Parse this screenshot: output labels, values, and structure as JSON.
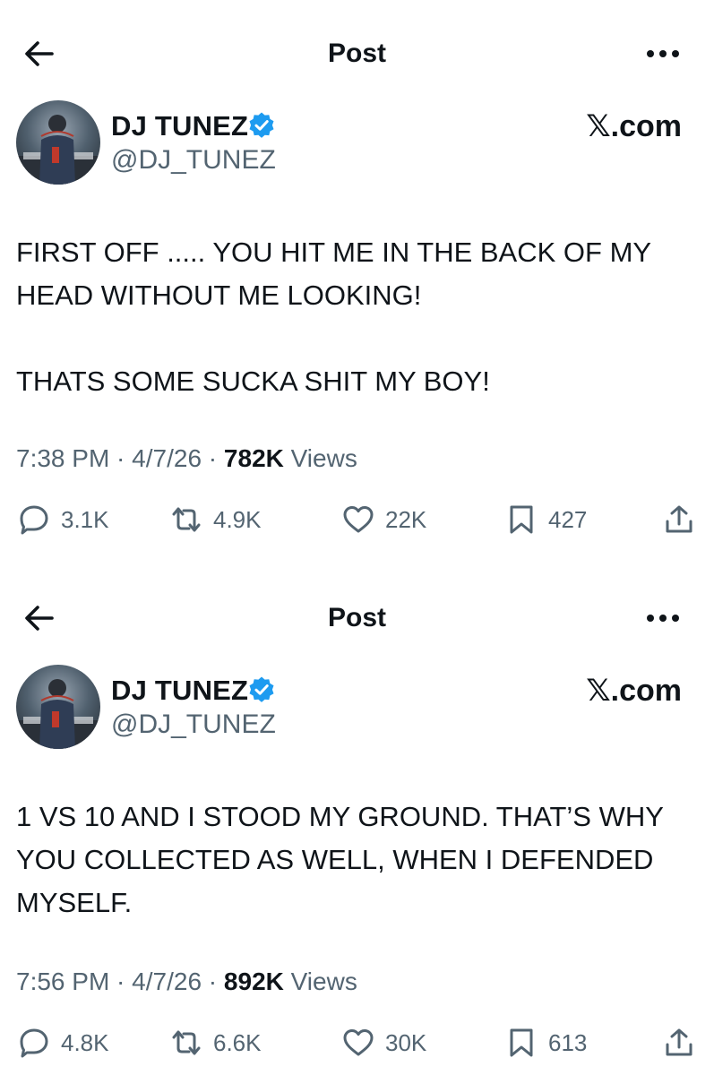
{
  "posts": [
    {
      "nav_title": "Post",
      "author": {
        "display_name": "DJ TUNEZ",
        "handle": "@DJ_TUNEZ",
        "verified": true
      },
      "brand": "𝕏.com",
      "text": "FIRST OFF ..... YOU HIT ME IN THE BACK OF MY HEAD WITHOUT ME LOOKING!\n\nTHATS SOME SUCKA SHIT MY BOY!",
      "time": "7:38 PM",
      "date": "4/7/26",
      "views_count": "782K",
      "views_label": "Views",
      "stats": {
        "replies": "3.1K",
        "reposts": "4.9K",
        "likes": "22K",
        "bookmarks": "427"
      }
    },
    {
      "nav_title": "Post",
      "author": {
        "display_name": "DJ TUNEZ",
        "handle": "@DJ_TUNEZ",
        "verified": true
      },
      "brand": "𝕏.com",
      "text": "1 VS 10 AND I STOOD MY GROUND. THAT’S WHY YOU COLLECTED AS WELL, WHEN I DEFENDED MYSELF.",
      "time": "7:56 PM",
      "date": "4/7/26",
      "views_count": "892K",
      "views_label": "Views",
      "stats": {
        "replies": "4.8K",
        "reposts": "6.6K",
        "likes": "30K",
        "bookmarks": "613"
      }
    }
  ],
  "colors": {
    "text": "#0f1419",
    "secondary": "#536471",
    "verified": "#1d9bf0",
    "background": "#ffffff"
  },
  "icons": [
    "back-arrow-icon",
    "more-icon",
    "verified-badge-icon",
    "reply-icon",
    "repost-icon",
    "like-icon",
    "bookmark-icon",
    "share-icon"
  ]
}
